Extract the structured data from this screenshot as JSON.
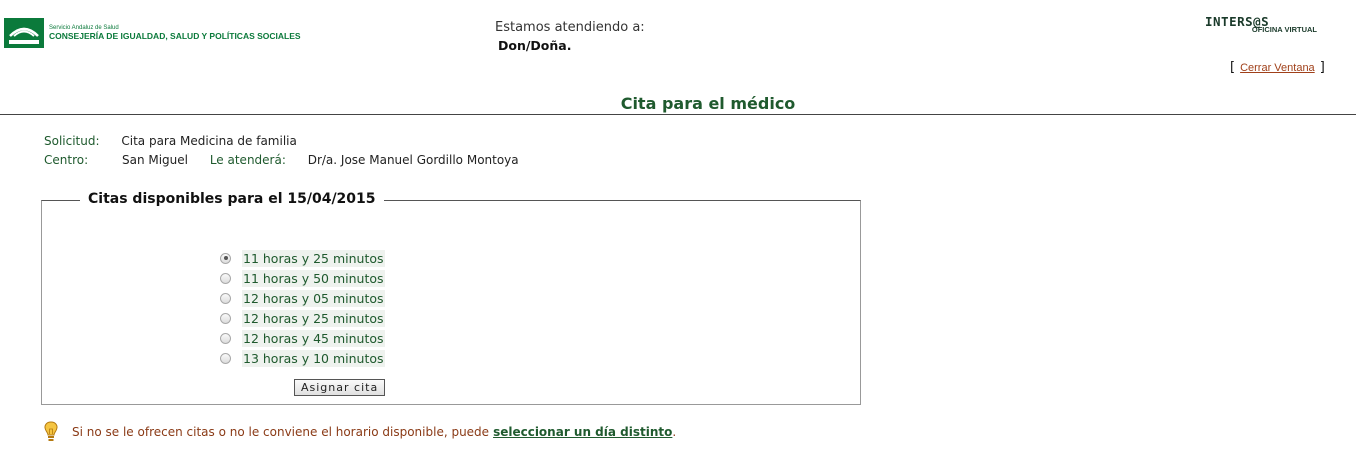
{
  "header": {
    "org_small": "Servicio Andaluz de Salud",
    "org_name": "CONSEJERÍA DE IGUALDAD, SALUD Y POLÍTICAS SOCIALES",
    "attending_label": "Estamos atendiendo a:",
    "attending_name": "Don/Doña.",
    "brand_main": "INTERS@S",
    "brand_sub": "OFICINA VIRTUAL",
    "close_open": "[",
    "close_label": "Cerrar Ventana",
    "close_close": "]"
  },
  "page": {
    "title": "Cita para el médico"
  },
  "request": {
    "solicitud_label": "Solicitud:",
    "solicitud_value": "Cita para Medicina de familia",
    "centro_label": "Centro:",
    "centro_value": "San Miguel",
    "doctor_label": "Le atenderá:",
    "doctor_value": "Dr/a. Jose Manuel Gordillo Montoya"
  },
  "slots": {
    "legend": "Citas disponibles para el 15/04/2015",
    "options": [
      "11 horas y 25 minutos",
      "11 horas y 50 minutos",
      "12 horas y 05 minutos",
      "12 horas y 25 minutos",
      "12 horas y 45 minutos",
      "13 horas y 10 minutos"
    ],
    "selected_index": 0,
    "button_label": "Asignar cita"
  },
  "tip": {
    "text": "Si no se le ofrecen citas o no le conviene el horario disponible, puede",
    "link": "seleccionar un día distinto",
    "end": "."
  }
}
